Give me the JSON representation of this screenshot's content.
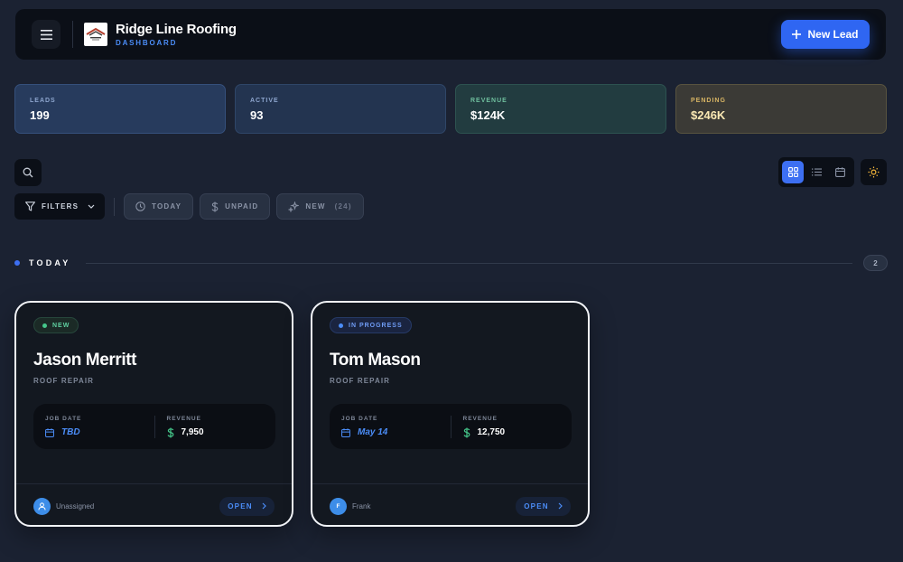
{
  "header": {
    "title": "Ridge Line Roofing",
    "subtitle": "DASHBOARD",
    "new_lead_label": "New Lead"
  },
  "stats": [
    {
      "label": "LEADS",
      "value": "199"
    },
    {
      "label": "ACTIVE",
      "value": "93"
    },
    {
      "label": "REVENUE",
      "value": "$124K"
    },
    {
      "label": "PENDING",
      "value": "$246K"
    }
  ],
  "filters": {
    "filters_label": "FILTERS",
    "chips": [
      {
        "label": "TODAY",
        "icon": "clock-icon"
      },
      {
        "label": "UNPAID",
        "icon": "dollar-icon"
      },
      {
        "label": "NEW",
        "count": "(24)",
        "icon": "sparkle-icon"
      }
    ]
  },
  "views": [
    "grid-view",
    "list-view",
    "calendar-view"
  ],
  "section": {
    "title": "TODAY",
    "count": "2"
  },
  "cards": [
    {
      "status": "NEW",
      "name": "Jason Merritt",
      "job": "ROOF REPAIR",
      "date_label": "JOB DATE",
      "date": "TBD",
      "revenue_label": "REVENUE",
      "revenue": "7,950",
      "assignee": "Unassigned",
      "avatar": "",
      "open_label": "OPEN"
    },
    {
      "status": "IN PROGRESS",
      "name": "Tom Mason",
      "job": "ROOF REPAIR",
      "date_label": "JOB DATE",
      "date": "May 14",
      "revenue_label": "REVENUE",
      "revenue": "12,750",
      "assignee": "Frank",
      "avatar": "F",
      "open_label": "OPEN"
    }
  ],
  "colors": {
    "accent": "#2f66f2",
    "new_status": "#45c88b",
    "progress_status": "#4b8df8",
    "pending": "#d8b564"
  }
}
